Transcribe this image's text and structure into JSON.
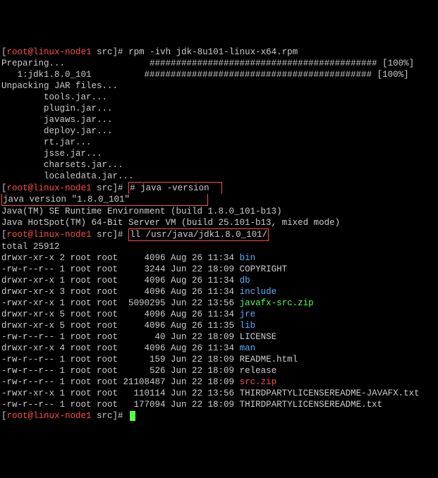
{
  "prompt_user": "root@linux-node1",
  "prompt_dir": "src",
  "cmd_rpm": "rpm -ivh jdk-8u101-linux-x64.rpm",
  "preparing": "Preparing...",
  "hashbar": "########################################### [100%]",
  "pkg_line": "   1:jdk1.8.0_101",
  "unpack": "Unpacking JAR files...",
  "jars": [
    "        tools.jar...",
    "        plugin.jar...",
    "        javaws.jar...",
    "        deploy.jar...",
    "        rt.jar...",
    "        jsse.jar...",
    "        charsets.jar...",
    "        localedata.jar..."
  ],
  "cmd_java": "java -version",
  "java_ver": "java version \"1.8.0_101\"",
  "java_rt": "Java(TM) SE Runtime Environment (build 1.8.0_101-b13)",
  "java_vm": "Java HotSpot(TM) 64-Bit Server VM (build 25.101-b13, mixed mode)",
  "cmd_ll": "ll /usr/java/jdk1.8.0_101/",
  "total": "total 25912",
  "ls": [
    {
      "perm": "drwxr-xr-x 2 root root     4096 Aug 26 11:34 ",
      "name": "bin",
      "cls": "cyan"
    },
    {
      "perm": "-rw-r--r-- 1 root root     3244 Jun 22 18:09 ",
      "name": "COPYRIGHT",
      "cls": "white"
    },
    {
      "perm": "drwxr-xr-x 1 root root     4096 Aug 26 11:34 ",
      "name": "db",
      "cls": "cyan"
    },
    {
      "perm": "drwxr-xr-x 3 root root     4096 Aug 26 11:34 ",
      "name": "include",
      "cls": "cyan"
    },
    {
      "perm": "-rwxr-xr-x 1 root root  5090295 Jun 22 13:56 ",
      "name": "javafx-src.zip",
      "cls": "green"
    },
    {
      "perm": "drwxr-xr-x 5 root root     4096 Aug 26 11:34 ",
      "name": "jre",
      "cls": "cyan"
    },
    {
      "perm": "drwxr-xr-x 5 root root     4096 Aug 26 11:35 ",
      "name": "lib",
      "cls": "cyan"
    },
    {
      "perm": "-rw-r--r-- 1 root root       40 Jun 22 18:09 ",
      "name": "LICENSE",
      "cls": "white"
    },
    {
      "perm": "drwxr-xr-x 4 root root     4096 Aug 26 11:34 ",
      "name": "man",
      "cls": "cyan"
    },
    {
      "perm": "-rw-r--r-- 1 root root      159 Jun 22 18:09 ",
      "name": "README.html",
      "cls": "white"
    },
    {
      "perm": "-rw-r--r-- 1 root root      526 Jun 22 18:09 ",
      "name": "release",
      "cls": "white"
    },
    {
      "perm": "-rw-r--r-- 1 root root 21108487 Jun 22 18:09 ",
      "name": "src.zip",
      "cls": "red"
    },
    {
      "perm": "-rwxr-xr-x 1 root root   110114 Jun 22 13:56 ",
      "name": "THIRDPARTYLICENSEREADME-JAVAFX.txt",
      "cls": "white"
    },
    {
      "perm": "-rw-r--r-- 1 root root   177094 Jun 22 18:09 ",
      "name": "THIRDPARTYLICENSEREADME.txt",
      "cls": "white"
    }
  ],
  "ps": "[",
  "pe": "]# "
}
